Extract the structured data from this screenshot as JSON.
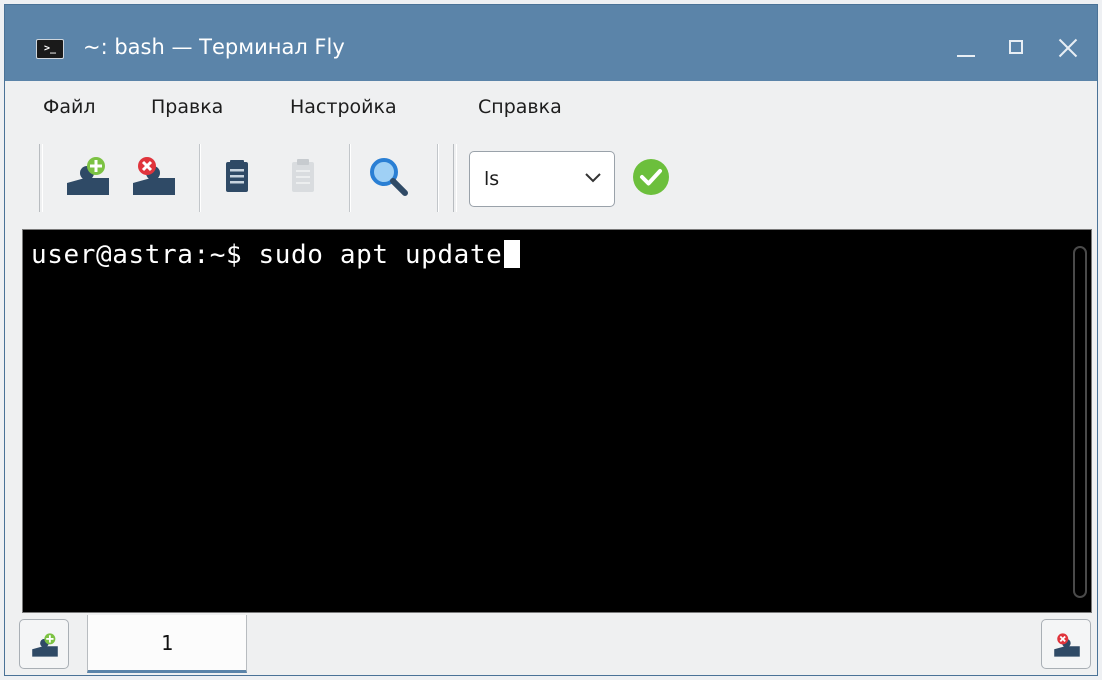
{
  "window": {
    "title": "~: bash — Терминал Fly",
    "app_icon_glyph": ">_",
    "controls": [
      "minimize-icon",
      "maximize-icon",
      "close-icon"
    ]
  },
  "menu": {
    "items": [
      {
        "label": "Файл"
      },
      {
        "label": "Правка"
      },
      {
        "label": "Настройка"
      },
      {
        "label": "Справка"
      }
    ]
  },
  "toolbar": {
    "buttons": [
      {
        "icon": "new-session-icon"
      },
      {
        "icon": "close-session-icon"
      },
      {
        "icon": "copy-icon"
      },
      {
        "icon": "paste-icon",
        "disabled": true
      },
      {
        "icon": "search-icon"
      }
    ],
    "command_combo": {
      "value": "ls"
    },
    "run_icon": "checkmark-circle-icon",
    "colors": {
      "run": "#6cbf3c",
      "session_add": "#7cc243",
      "session_close": "#e0343c",
      "search": "#2a7fd4"
    }
  },
  "terminal": {
    "prompt": "user@astra:~$ ",
    "command": "sudo apt update",
    "background": "#000000",
    "foreground": "#ffffff"
  },
  "tabs": {
    "items": [
      {
        "label": "1",
        "active": true
      }
    ],
    "left_button_icon": "new-tab-icon",
    "right_button_icon": "close-tab-icon"
  }
}
